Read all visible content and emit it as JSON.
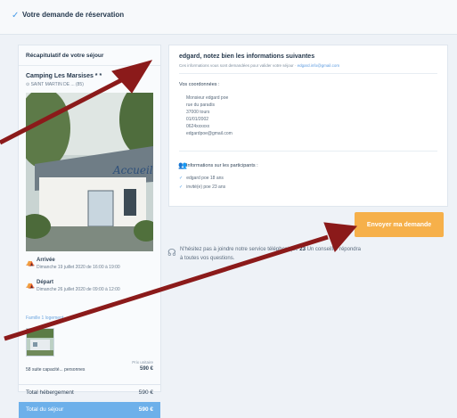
{
  "header": {
    "check_icon": "check-icon",
    "title": "Votre demande de réservation"
  },
  "summary": {
    "heading": "Récapitulatif de votre séjour",
    "camping_name": "Camping Les Marsises * *",
    "location": "SAINT MARTIN DE ... (85)",
    "photo_sign": "Accueil",
    "arrival_label": "Arrivée",
    "arrival_value": "Dimanche 19 juillet 2020 de 16:00 à 19:00",
    "departure_label": "Départ",
    "departure_value": "Dimanche 26 juillet 2020 de 09:00 à 12:00",
    "family_label": "Famille 1 logement",
    "capacity": "58 suite capacité... personnes",
    "unit_price_label": "Prix unitaire",
    "unit_price": "590 €",
    "total_hebergement_label": "Total hébergement",
    "total_hebergement_value": "590 €",
    "total_sejour_label": "Total du séjour",
    "total_sejour_value": "590 €"
  },
  "info": {
    "title": "edgard, notez bien les informations suivantes",
    "subtitle": "Ces informations vous sont demandées pour valider votre séjour",
    "subtitle_link": "edgard.info@gmail.com",
    "coords_heading": "Vos coordonnées :",
    "coords": [
      "Monsieur edgard poe",
      "rue du paradis",
      "37000 tours",
      "01/01/2002",
      "0624xxxxxx",
      "edgardpoe@gmail.com"
    ],
    "participants_heading": "Informations sur les participants :",
    "participants": [
      "edgard poe 18 ans",
      "invité(e) poe 23 ans"
    ]
  },
  "actions": {
    "send_label": "Envoyer ma demande"
  },
  "help": {
    "line1_pre": "N'hésitez pas à joindre notre service téléphonique",
    "line1_bold": "23",
    "line1_post": "Un conseiller répondra",
    "line2": "à toutes vos questions."
  },
  "colors": {
    "accent_blue": "#4a9ce8",
    "button_orange": "#f6b04a",
    "total_bar": "#6db0ea",
    "arrow_red": "#8b1a1a"
  }
}
